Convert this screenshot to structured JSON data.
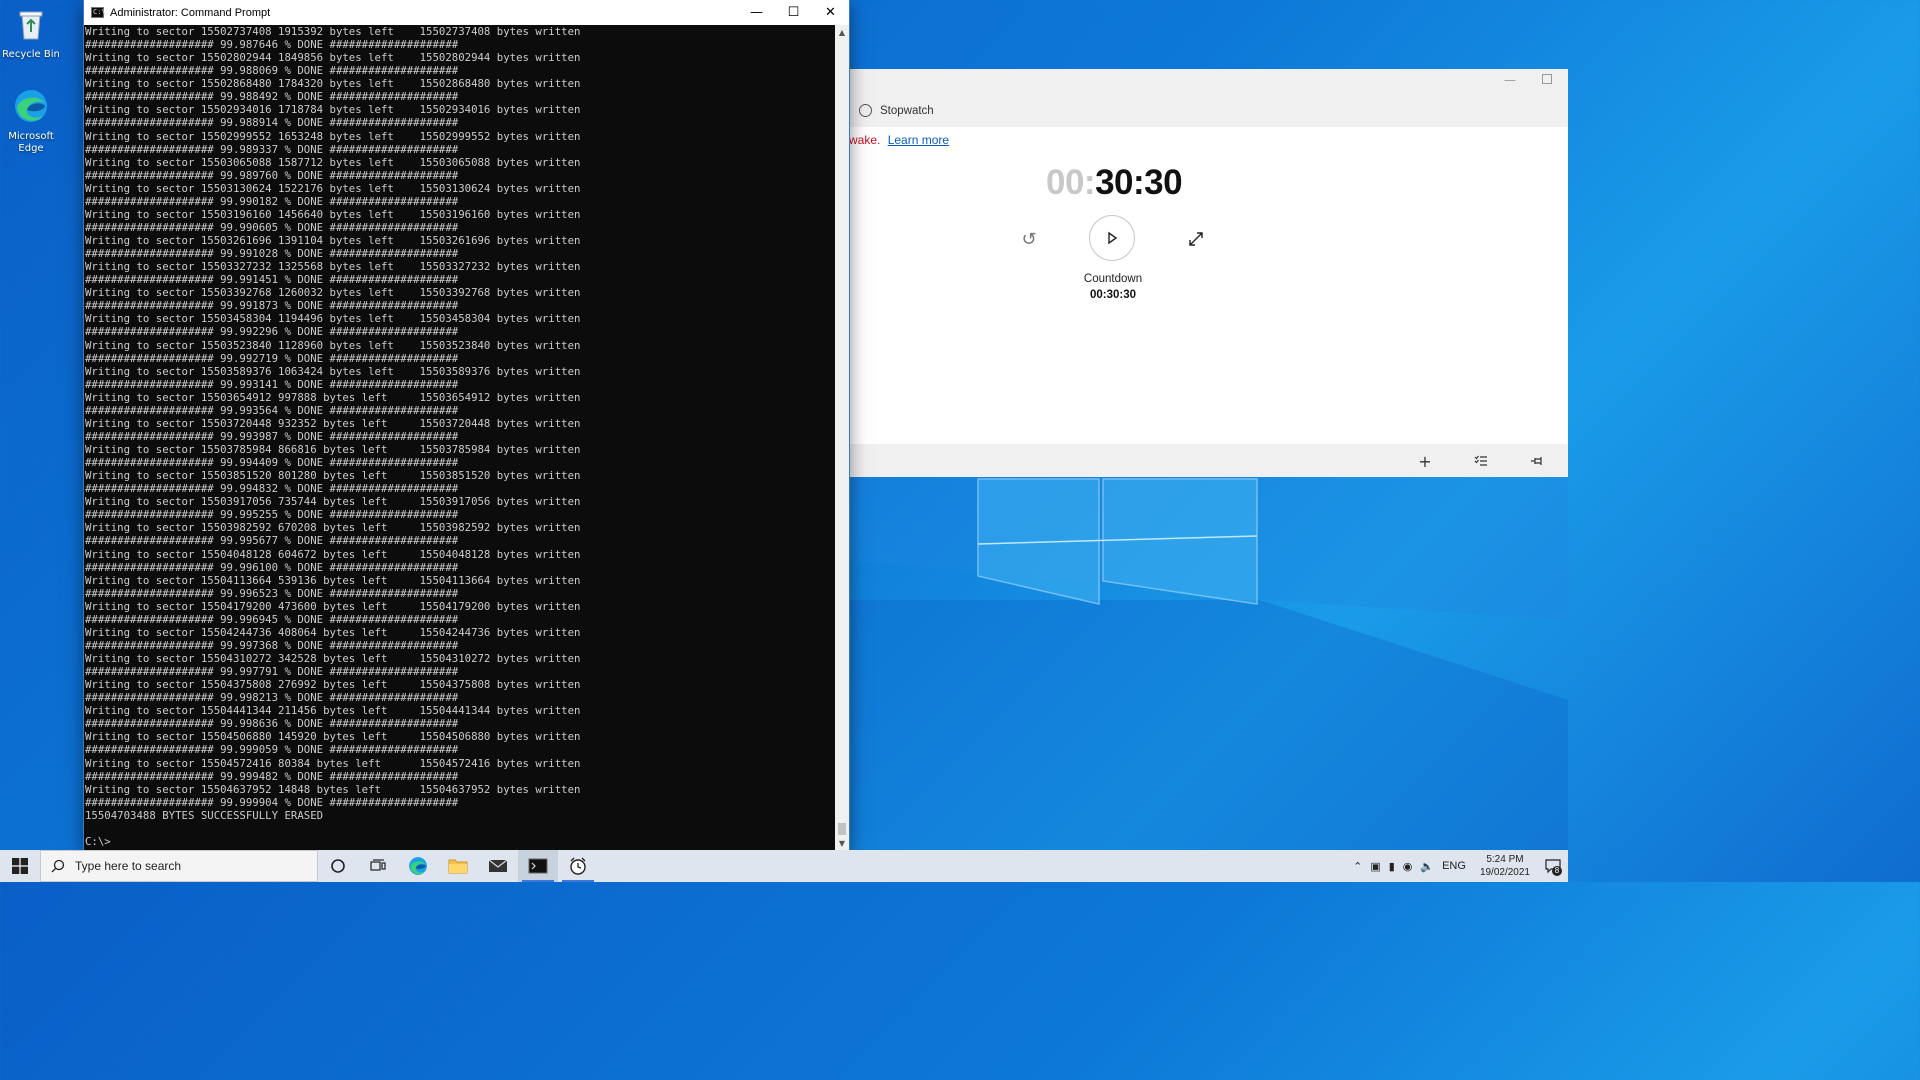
{
  "desktop": {
    "icons": [
      {
        "label": "Recycle Bin",
        "icon": "recycle-bin-icon"
      },
      {
        "label": "Microsoft Edge",
        "icon": "edge-icon"
      }
    ]
  },
  "cmd_window": {
    "title": "Administrator: Command Prompt",
    "log": [
      {
        "sector": "15502737408",
        "left": "1915392",
        "written": "15502737408",
        "pct": "99.987646"
      },
      {
        "sector": "15502802944",
        "left": "1849856",
        "written": "15502802944",
        "pct": "99.988069"
      },
      {
        "sector": "15502868480",
        "left": "1784320",
        "written": "15502868480",
        "pct": "99.988492"
      },
      {
        "sector": "15502934016",
        "left": "1718784",
        "written": "15502934016",
        "pct": "99.988914"
      },
      {
        "sector": "15502999552",
        "left": "1653248",
        "written": "15502999552",
        "pct": "99.989337"
      },
      {
        "sector": "15503065088",
        "left": "1587712",
        "written": "15503065088",
        "pct": "99.989760"
      },
      {
        "sector": "15503130624",
        "left": "1522176",
        "written": "15503130624",
        "pct": "99.990182"
      },
      {
        "sector": "15503196160",
        "left": "1456640",
        "written": "15503196160",
        "pct": "99.990605"
      },
      {
        "sector": "15503261696",
        "left": "1391104",
        "written": "15503261696",
        "pct": "99.991028"
      },
      {
        "sector": "15503327232",
        "left": "1325568",
        "written": "15503327232",
        "pct": "99.991451"
      },
      {
        "sector": "15503392768",
        "left": "1260032",
        "written": "15503392768",
        "pct": "99.991873"
      },
      {
        "sector": "15503458304",
        "left": "1194496",
        "written": "15503458304",
        "pct": "99.992296"
      },
      {
        "sector": "15503523840",
        "left": "1128960",
        "written": "15503523840",
        "pct": "99.992719"
      },
      {
        "sector": "15503589376",
        "left": "1063424",
        "written": "15503589376",
        "pct": "99.993141"
      },
      {
        "sector": "15503654912",
        "left": "997888",
        "written": "15503654912",
        "pct": "99.993564"
      },
      {
        "sector": "15503720448",
        "left": "932352",
        "written": "15503720448",
        "pct": "99.993987"
      },
      {
        "sector": "15503785984",
        "left": "866816",
        "written": "15503785984",
        "pct": "99.994409"
      },
      {
        "sector": "15503851520",
        "left": "801280",
        "written": "15503851520",
        "pct": "99.994832"
      },
      {
        "sector": "15503917056",
        "left": "735744",
        "written": "15503917056",
        "pct": "99.995255"
      },
      {
        "sector": "15503982592",
        "left": "670208",
        "written": "15503982592",
        "pct": "99.995677"
      },
      {
        "sector": "15504048128",
        "left": "604672",
        "written": "15504048128",
        "pct": "99.996100"
      },
      {
        "sector": "15504113664",
        "left": "539136",
        "written": "15504113664",
        "pct": "99.996523"
      },
      {
        "sector": "15504179200",
        "left": "473600",
        "written": "15504179200",
        "pct": "99.996945"
      },
      {
        "sector": "15504244736",
        "left": "408064",
        "written": "15504244736",
        "pct": "99.997368"
      },
      {
        "sector": "15504310272",
        "left": "342528",
        "written": "15504310272",
        "pct": "99.997791"
      },
      {
        "sector": "15504375808",
        "left": "276992",
        "written": "15504375808",
        "pct": "99.998213"
      },
      {
        "sector": "15504441344",
        "left": "211456",
        "written": "15504441344",
        "pct": "99.998636"
      },
      {
        "sector": "15504506880",
        "left": "145920",
        "written": "15504506880",
        "pct": "99.999059"
      },
      {
        "sector": "15504572416",
        "left": "80384",
        "written": "15504572416",
        "pct": "99.999482"
      },
      {
        "sector": "15504637952",
        "left": "14848",
        "written": "15504637952",
        "pct": "99.999904"
      }
    ],
    "final_line": "15504703488 BYTES SUCCESSFULLY ERASED",
    "prompt": "C:\\>"
  },
  "clock_window": {
    "tab": "Stopwatch",
    "notice_red": "wake.",
    "notice_link": "Learn more",
    "time_dim": "00:",
    "time_main": "30:30",
    "timer_name": "Countdown",
    "timer_value": "00:30:30"
  },
  "taskbar": {
    "search_placeholder": "Type here to search",
    "language": "ENG",
    "time": "5:24 PM",
    "date": "19/02/2021",
    "notification_count": "8"
  },
  "colors": {
    "accent": "#3b78d8",
    "cmd_bg": "#0c0c0c",
    "cmd_text": "#cccccc",
    "notice_red": "#c50f1f",
    "link": "#0a5dbb"
  }
}
